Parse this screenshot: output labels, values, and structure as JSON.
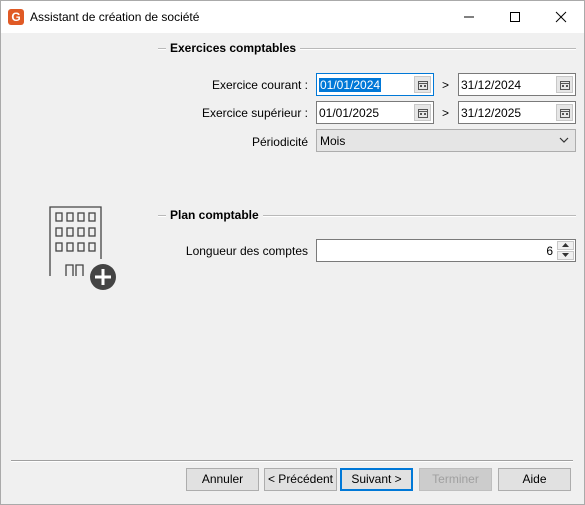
{
  "window": {
    "title": "Assistant de création de société",
    "logo_letter": "G",
    "accent_color": "#e05a25"
  },
  "exercices": {
    "section_title": "Exercices comptables",
    "courant_label": "Exercice courant :",
    "courant_start": "01/01/2024",
    "courant_end": "31/12/2024",
    "superieur_label": "Exercice supérieur :",
    "superieur_start": "01/01/2025",
    "superieur_end": "31/12/2025",
    "separator": ">",
    "periodicite_label": "Périodicité",
    "periodicite_value": "Mois"
  },
  "plan": {
    "section_title": "Plan comptable",
    "longueur_label": "Longueur des comptes",
    "longueur_value": "6"
  },
  "footer": {
    "annuler": "Annuler",
    "precedent": "< Précédent",
    "suivant": "Suivant >",
    "terminer": "Terminer",
    "aide": "Aide"
  },
  "icons": {
    "calendar": "calendar-icon",
    "chevron": "chevron-down-icon",
    "illustration": "building-add-icon"
  }
}
